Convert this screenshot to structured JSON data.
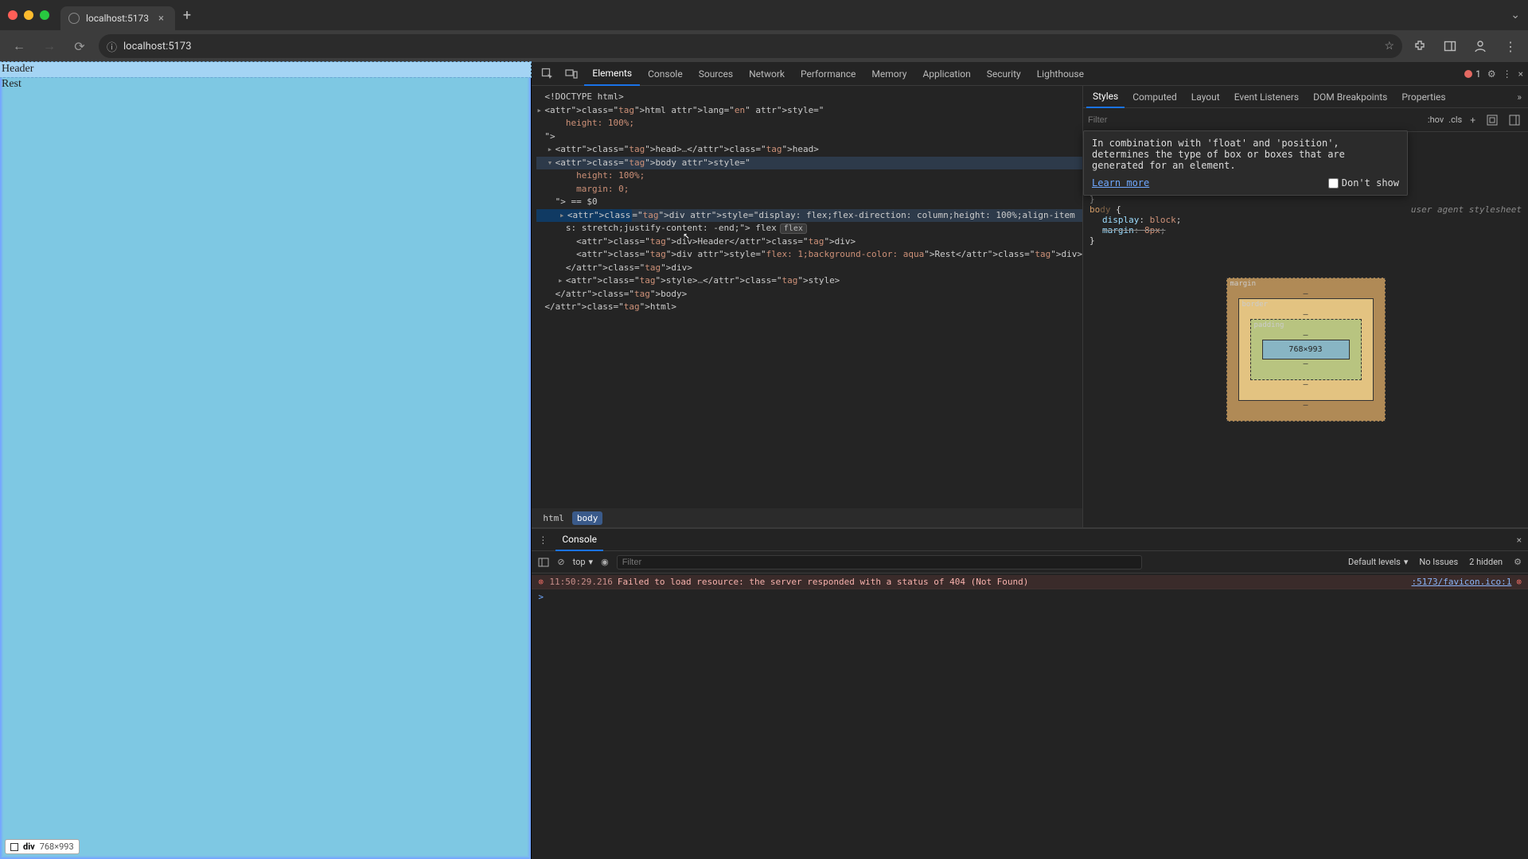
{
  "browser": {
    "tab_title": "localhost:5173",
    "url": "localhost:5173",
    "newtab_tooltip": "+"
  },
  "page": {
    "header_text": "Header",
    "rest_text": "Rest",
    "badge_tag": "div",
    "badge_dims": "768×993"
  },
  "devtools": {
    "inspect_tooltip": "Select element",
    "device_tooltip": "Toggle device toolbar",
    "tabs": [
      "Elements",
      "Console",
      "Sources",
      "Network",
      "Performance",
      "Memory",
      "Application",
      "Security",
      "Lighthouse"
    ],
    "active_tab": "Elements",
    "error_count": "1",
    "breadcrumb": [
      "html",
      "body"
    ],
    "dom_lines": [
      {
        "indent": 0,
        "html": "<!DOCTYPE html>",
        "type": "plain"
      },
      {
        "indent": 0,
        "html": "<html lang=\"en\" style=\"",
        "type": "open"
      },
      {
        "indent": 2,
        "html": "height: 100%;",
        "type": "style"
      },
      {
        "indent": 0,
        "html": "\">",
        "type": "close-start"
      },
      {
        "indent": 1,
        "html": "<head>…</head>",
        "type": "collapsed"
      },
      {
        "indent": 1,
        "html": "<body style=\"",
        "type": "open",
        "selected": true
      },
      {
        "indent": 3,
        "html": "height: 100%;",
        "type": "style"
      },
      {
        "indent": 3,
        "html": "margin: 0;",
        "type": "style"
      },
      {
        "indent": 1,
        "html": "\"> == $0",
        "type": "close-start"
      },
      {
        "indent": 2,
        "html": "<div style=\"display: flex;flex-direction: column;height: 100%;align-item",
        "type": "open",
        "hover": true
      },
      {
        "indent": 2,
        "html": "s: stretch;justify-content: flex-end;\"> flex",
        "type": "cont",
        "badge": "flex"
      },
      {
        "indent": 3,
        "html": "<div>Header</div>",
        "type": "leaf"
      },
      {
        "indent": 3,
        "html": "<div style=\"flex: 1;background-color: aqua\">Rest</div>",
        "type": "leaf"
      },
      {
        "indent": 2,
        "html": "</div>",
        "type": "close"
      },
      {
        "indent": 2,
        "html": "<style>…</style>",
        "type": "collapsed"
      },
      {
        "indent": 1,
        "html": "</body>",
        "type": "close"
      },
      {
        "indent": 0,
        "html": "</html>",
        "type": "close"
      }
    ],
    "styles_tabs": [
      "Styles",
      "Computed",
      "Layout",
      "Event Listeners",
      "DOM Breakpoints",
      "Properties"
    ],
    "styles_active": "Styles",
    "filter_placeholder": "Filter",
    "hov_label": ":hov",
    "cls_label": ".cls",
    "tooltip": "In combination with 'float' and 'position', determines the type of box or boxes that are generated for an element.",
    "learn_more": "Learn more",
    "dont_show": "Don't show",
    "agent_label": "user agent stylesheet",
    "rule_selector": "body",
    "rule_props": [
      {
        "name": "display",
        "value": "block",
        "strike": false
      },
      {
        "name": "margin",
        "value": "8px",
        "strike": true
      }
    ],
    "boxmodel": {
      "margin": "margin",
      "border": "border",
      "padding": "padding",
      "dims": "768×993",
      "dash": "–"
    }
  },
  "console": {
    "tab": "Console",
    "context": "top",
    "filter_placeholder": "Filter",
    "default_levels": "Default levels",
    "no_issues": "No Issues",
    "hidden": "2 hidden",
    "error": {
      "time": "11:50:29.216",
      "msg": "Failed to load resource: the server responded with a status of 404 (Not Found)",
      "src": ":5173/favicon.ico:1"
    },
    "prompt": ">"
  }
}
